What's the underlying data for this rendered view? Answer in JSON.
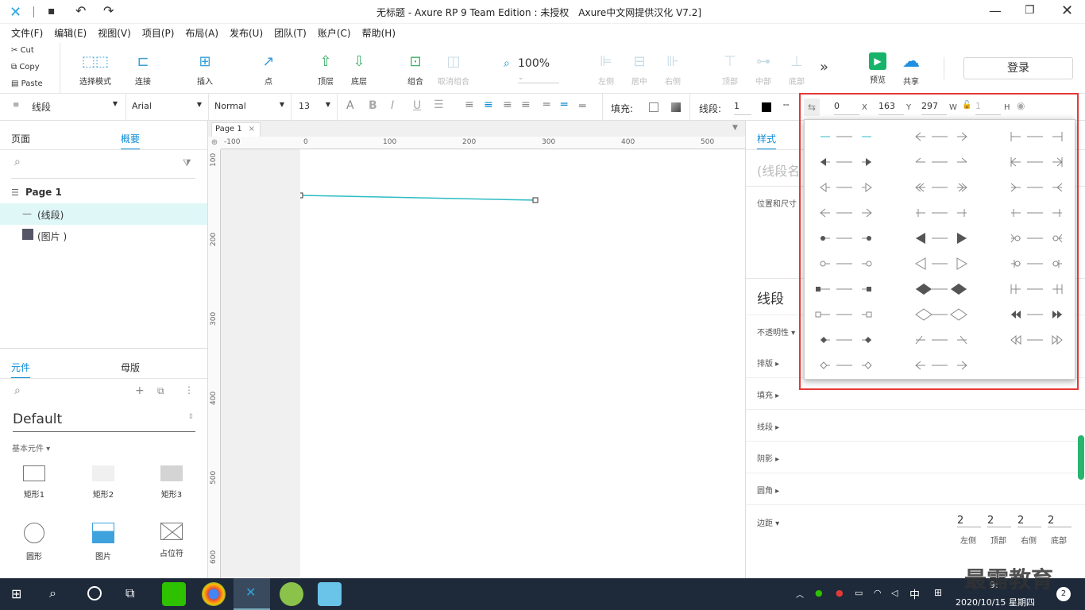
{
  "window": {
    "title": "无标题 - Axure RP 9 Team Edition : 未授权　Axure中文网提供汉化 V7.2]"
  },
  "menu": [
    "文件(F)",
    "编辑(E)",
    "视图(V)",
    "项目(P)",
    "布局(A)",
    "发布(U)",
    "团队(T)",
    "账户(C)",
    "帮助(H)"
  ],
  "clipboard": {
    "cut": "Cut",
    "copy": "Copy",
    "paste": "Paste"
  },
  "toolbar": {
    "select_mode": "选择模式",
    "connect": "连接",
    "insert": "插入",
    "point": "点",
    "top_layer": "顶层",
    "bottom_layer": "底层",
    "group": "组合",
    "ungroup": "取消组合",
    "zoom": "100%",
    "align_left": "左侧",
    "align_center": "居中",
    "align_right": "右侧",
    "align_top": "顶部",
    "align_middle": "中部",
    "align_bottom": "底部",
    "more": "»",
    "preview": "预览",
    "share": "共享",
    "login": "登录"
  },
  "style_bar": {
    "element_type": "线段",
    "font": "Arial",
    "weight": "Normal",
    "size": "13",
    "fill_label": "填充:",
    "line_label": "线段:",
    "line_width": "1",
    "x": "0",
    "x_label": "X",
    "y": "163",
    "y_label": "Y",
    "w": "297",
    "w_label": "W",
    "h": "1",
    "h_label": "H"
  },
  "left_panel": {
    "tab_pages": "页面",
    "tab_outline": "概要",
    "page_name": "Page 1",
    "outline_items": [
      "(线段)",
      "(图片 )"
    ],
    "tab_widgets": "元件",
    "tab_masters": "母版",
    "library": "Default",
    "category": "基本元件 ▾",
    "widgets": [
      "矩形1",
      "矩形2",
      "矩形3",
      "圆形",
      "图片",
      "占位符"
    ]
  },
  "canvas": {
    "tab": "Page 1",
    "ruler_h": [
      "-100",
      "0",
      "100",
      "200",
      "300",
      "400",
      "500"
    ],
    "ruler_v": [
      "100",
      "200",
      "300",
      "400",
      "500",
      "600"
    ],
    "line_color": "#2bbcc4"
  },
  "right_panel": {
    "tab_style": "样式",
    "name_placeholder": "(线段名",
    "pos_size": "位置和尺寸",
    "section_title": "线段",
    "opacity": "不透明性 ▾",
    "rows": [
      "排版 ▸",
      "填充 ▸",
      "线段 ▸",
      "阴影 ▸",
      "圆角 ▸"
    ],
    "padding_label": "边距 ▾",
    "padding": [
      {
        "value": "2",
        "label": "左侧"
      },
      {
        "value": "2",
        "label": "顶部"
      },
      {
        "value": "2",
        "label": "右侧"
      },
      {
        "value": "2",
        "label": "底部"
      }
    ]
  },
  "arrow_popup": {
    "columns": 3,
    "options_count": 29
  },
  "taskbar": {
    "ime": "中",
    "time": "9:",
    "date": "2020/10/15 星期四",
    "notif_count": "2",
    "watermark": "最需教育"
  },
  "colors": {
    "accent": "#0a8bd6",
    "highlight_box": "#e53935",
    "selected_row": "#e0f7f8"
  }
}
